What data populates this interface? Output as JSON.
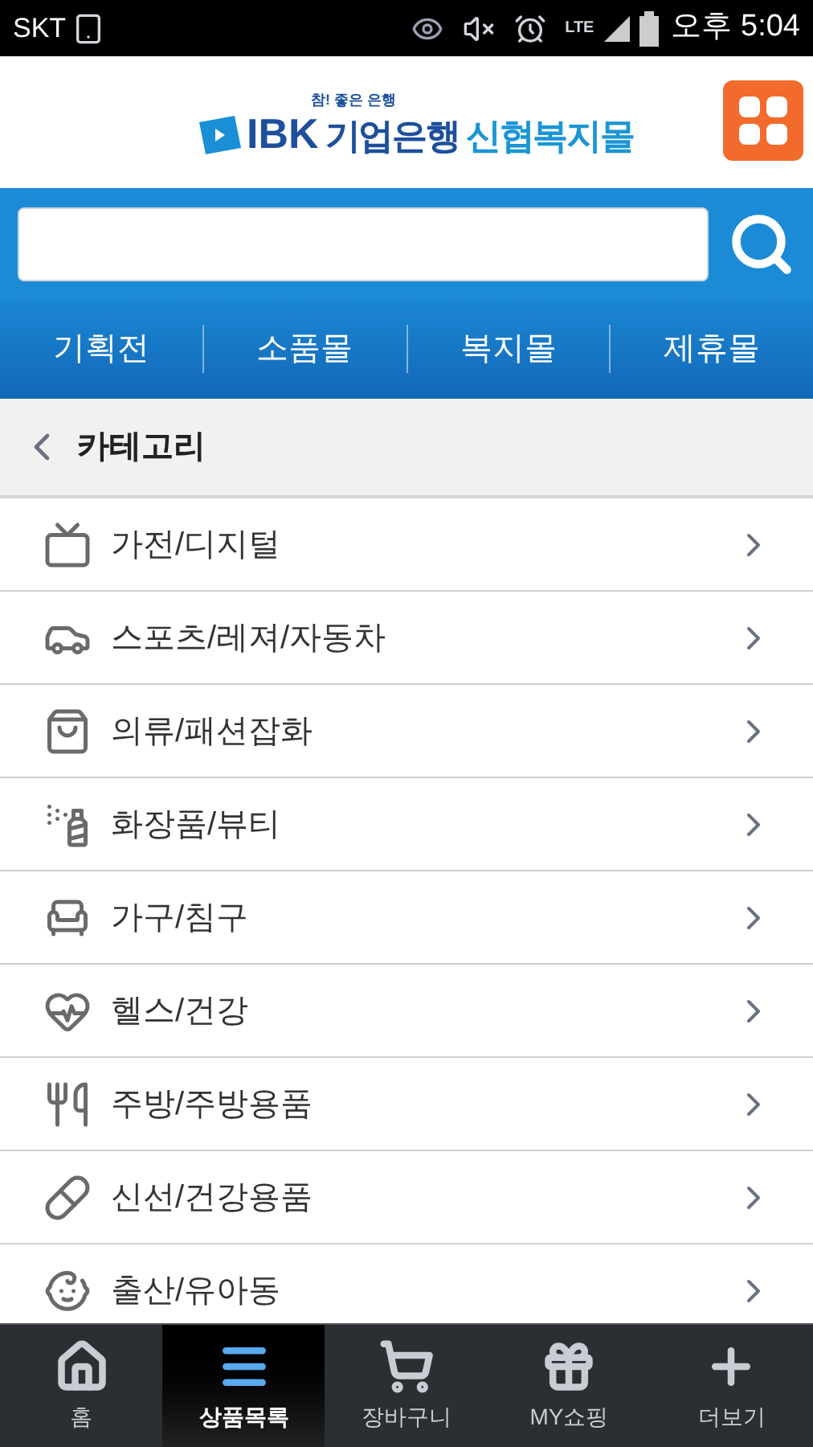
{
  "status_bar": {
    "carrier": "SKT",
    "network": "LTE",
    "time": "오후 5:04"
  },
  "header": {
    "logo": {
      "slogan": "참! 좋은 은행",
      "brand": "IBK",
      "bank": "기업은행",
      "mall": "신협복지몰"
    }
  },
  "tabs": [
    {
      "label": "기획전",
      "selected": false
    },
    {
      "label": "소품몰",
      "selected": false
    },
    {
      "label": "복지몰",
      "selected": false
    },
    {
      "label": "제휴몰",
      "selected": false
    }
  ],
  "category_header": {
    "title": "카테고리"
  },
  "categories": [
    {
      "label": "가전/디지털"
    },
    {
      "label": "스포츠/레져/자동차"
    },
    {
      "label": "의류/패션잡화"
    },
    {
      "label": "화장품/뷰티"
    },
    {
      "label": "가구/침구"
    },
    {
      "label": "헬스/건강"
    },
    {
      "label": "주방/주방용품"
    },
    {
      "label": "신선/건강용품"
    },
    {
      "label": "출산/유아동"
    }
  ],
  "bottom_nav": [
    {
      "label": "홈",
      "selected": false
    },
    {
      "label": "상품목록",
      "selected": true
    },
    {
      "label": "장바구니",
      "selected": false
    },
    {
      "label": "MY쇼핑",
      "selected": false
    },
    {
      "label": "더보기",
      "selected": false
    }
  ]
}
